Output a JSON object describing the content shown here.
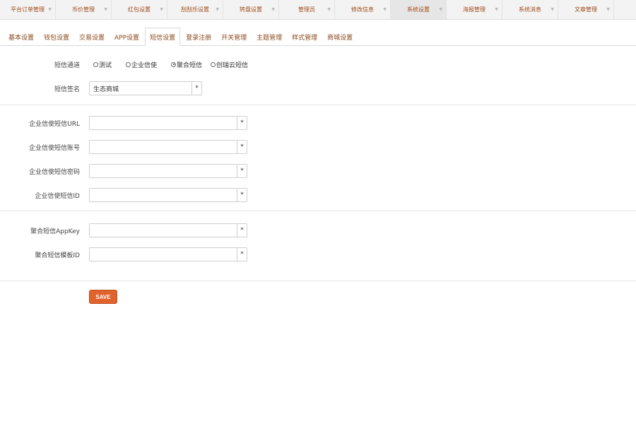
{
  "menu": {
    "items": [
      {
        "label": "平台订单管理"
      },
      {
        "label": "币价管理"
      },
      {
        "label": "红包设置"
      },
      {
        "label": "刮刮乐设置"
      },
      {
        "label": "转盘设置"
      },
      {
        "label": "管理员"
      },
      {
        "label": "修改信息"
      },
      {
        "label": "系统设置"
      },
      {
        "label": "海报管理"
      },
      {
        "label": "系统消息"
      },
      {
        "label": "文章管理"
      }
    ],
    "active_index": 7
  },
  "tabs": {
    "items": [
      {
        "label": "基本设置"
      },
      {
        "label": "钱包设置"
      },
      {
        "label": "交易设置"
      },
      {
        "label": "APP设置"
      },
      {
        "label": "短信设置"
      },
      {
        "label": "登录注册"
      },
      {
        "label": "开关管理"
      },
      {
        "label": "主题管理"
      },
      {
        "label": "样式管理"
      },
      {
        "label": "商城设置"
      }
    ],
    "active_index": 4
  },
  "form": {
    "channel": {
      "label": "短信通道",
      "options": [
        "测试",
        "企业信使",
        "聚合短信",
        "创瑞云短信"
      ],
      "selected_index": 2
    },
    "signature": {
      "label": "短信签名",
      "value": "生态商城",
      "required_mark": "*"
    },
    "qyxs_url": {
      "label": "企业信使短信URL",
      "value": "",
      "required_mark": "*"
    },
    "qyxs_account": {
      "label": "企业信使短信账号",
      "value": "",
      "required_mark": "*"
    },
    "qyxs_password": {
      "label": "企业信使短信密码",
      "value": "",
      "required_mark": "*"
    },
    "qyxs_id": {
      "label": "企业信使短信ID",
      "value": "",
      "required_mark": "*"
    },
    "juhe_appkey": {
      "label": "聚合短信AppKey",
      "value": "",
      "required_mark": "*"
    },
    "juhe_template": {
      "label": "聚合短信模板ID",
      "value": "",
      "required_mark": "*"
    }
  },
  "save_label": "SAVE",
  "colors": {
    "accent": "#e0622d",
    "menu_text": "#a04a1a",
    "tab_text": "#8a4a1c"
  }
}
